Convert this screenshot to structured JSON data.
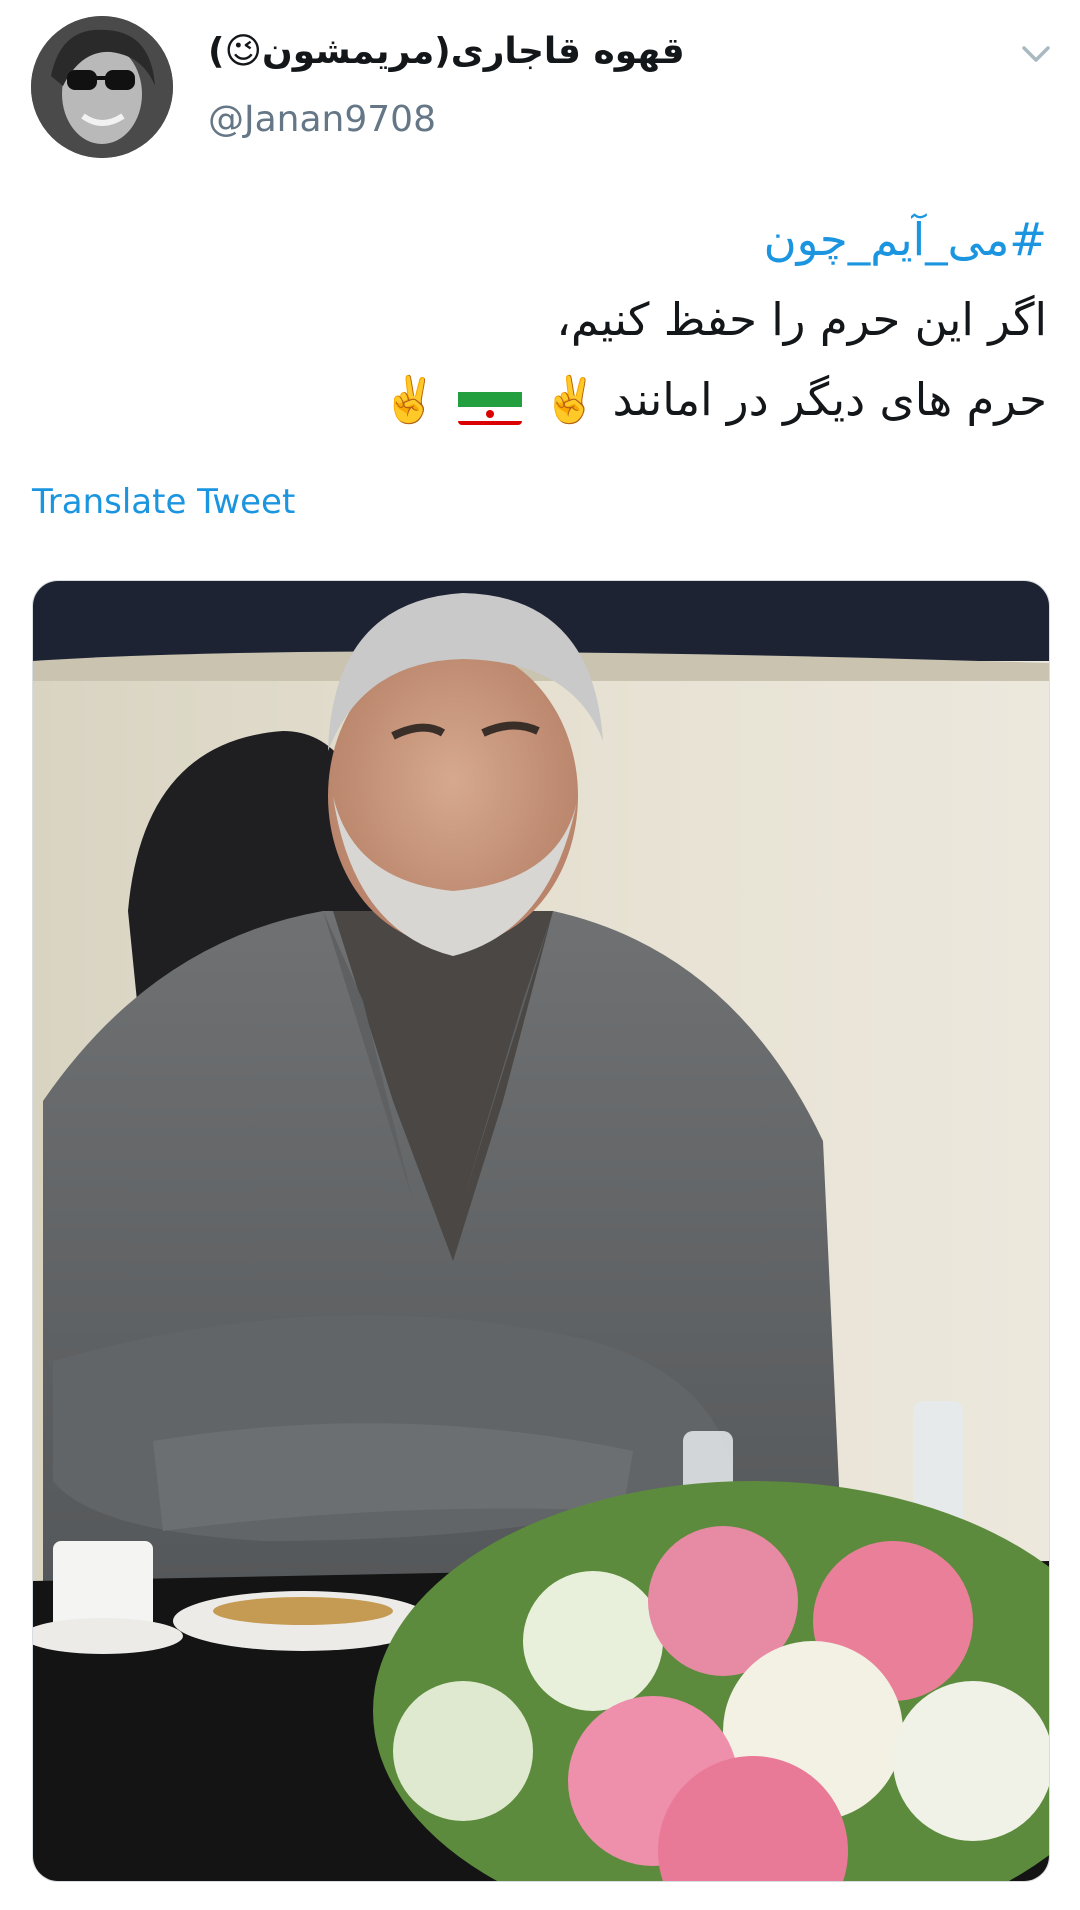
{
  "tweet": {
    "display_name": "قهوه قاجاری(مریمشون😉)",
    "handle": "@Janan9708",
    "lines": [
      "#می_آیم_چون",
      "اگر این حرم را حفظ کنیم،",
      "حرم های دیگر در امانند"
    ],
    "line3_emojis": [
      "✌️",
      "✌️"
    ],
    "translate_label": "Translate Tweet"
  },
  "icons": {
    "avatar": "user-avatar",
    "menu": "chevron-down-icon",
    "flag": "iran-flag-emoji"
  },
  "colors": {
    "link": "#1b95e0",
    "text": "#14171a",
    "muted": "#657786"
  }
}
